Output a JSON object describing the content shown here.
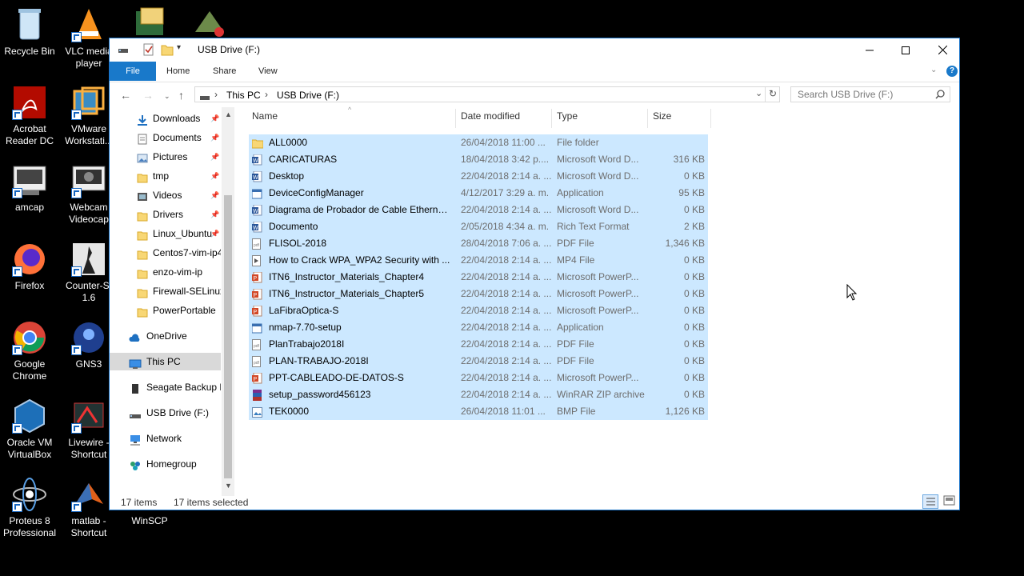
{
  "desktop": {
    "icons": [
      {
        "label": "Recycle Bin"
      },
      {
        "label": "VLC media player"
      },
      {
        "label": "Acrobat Reader DC"
      },
      {
        "label": "VMware Workstati..."
      },
      {
        "label": "amcap"
      },
      {
        "label": "Webcam Videocap"
      },
      {
        "label": "Firefox"
      },
      {
        "label": "Counter-St 1.6"
      },
      {
        "label": "Google Chrome"
      },
      {
        "label": "GNS3"
      },
      {
        "label": "Oracle VM VirtualBox"
      },
      {
        "label": "Livewire - Shortcut"
      },
      {
        "label": "Proteus 8 Professional"
      },
      {
        "label": "matlab - Shortcut"
      },
      {
        "label": "WinSCP"
      }
    ]
  },
  "window": {
    "title": "USB Drive (F:)",
    "ribbon_tabs": [
      "File",
      "Home",
      "Share",
      "View"
    ],
    "address": {
      "segments": [
        "This PC",
        "USB Drive (F:)"
      ]
    },
    "search_placeholder": "Search USB Drive (F:)",
    "nav": {
      "quick_access": [
        {
          "label": "Downloads",
          "pinned": true
        },
        {
          "label": "Documents",
          "pinned": true
        },
        {
          "label": "Pictures",
          "pinned": true
        },
        {
          "label": "tmp",
          "pinned": true
        },
        {
          "label": "Videos",
          "pinned": true
        },
        {
          "label": "Drivers",
          "pinned": true
        },
        {
          "label": "Linux_Ubuntu",
          "pinned": true
        },
        {
          "label": "Centos7-vim-ip4",
          "pinned": false
        },
        {
          "label": "enzo-vim-ip",
          "pinned": false
        },
        {
          "label": "Firewall-SELinux",
          "pinned": false
        },
        {
          "label": "PowerPortable",
          "pinned": false
        }
      ],
      "locations": [
        {
          "label": "OneDrive"
        },
        {
          "label": "This PC"
        },
        {
          "label": "Seagate Backup P"
        },
        {
          "label": "USB Drive (F:)"
        },
        {
          "label": "Network"
        },
        {
          "label": "Homegroup"
        }
      ]
    },
    "columns": [
      "Name",
      "Date modified",
      "Type",
      "Size"
    ],
    "files": [
      {
        "name": "ALL0000",
        "date": "26/04/2018 11:00 ...",
        "type": "File folder",
        "size": "",
        "icon": "folder"
      },
      {
        "name": "CARICATURAS",
        "date": "18/04/2018 3:42 p....",
        "type": "Microsoft Word D...",
        "size": "316 KB",
        "icon": "word"
      },
      {
        "name": "Desktop",
        "date": "22/04/2018 2:14 a. ...",
        "type": "Microsoft Word D...",
        "size": "0 KB",
        "icon": "word"
      },
      {
        "name": "DeviceConfigManager",
        "date": "4/12/2017 3:29 a. m.",
        "type": "Application",
        "size": "95 KB",
        "icon": "app"
      },
      {
        "name": "Diagrama de Probador de Cable Ethernet...",
        "date": "22/04/2018 2:14 a. ...",
        "type": "Microsoft Word D...",
        "size": "0 KB",
        "icon": "word"
      },
      {
        "name": "Documento",
        "date": "2/05/2018 4:34 a. m.",
        "type": "Rich Text Format",
        "size": "2 KB",
        "icon": "word"
      },
      {
        "name": "FLISOL-2018",
        "date": "28/04/2018 7:06 a. ...",
        "type": "PDF File",
        "size": "1,346 KB",
        "icon": "pdf"
      },
      {
        "name": "How to Crack WPA_WPA2 Security with ...",
        "date": "22/04/2018 2:14 a. ...",
        "type": "MP4 File",
        "size": "0 KB",
        "icon": "video"
      },
      {
        "name": "ITN6_Instructor_Materials_Chapter4",
        "date": "22/04/2018 2:14 a. ...",
        "type": "Microsoft PowerP...",
        "size": "0 KB",
        "icon": "ppt"
      },
      {
        "name": "ITN6_Instructor_Materials_Chapter5",
        "date": "22/04/2018 2:14 a. ...",
        "type": "Microsoft PowerP...",
        "size": "0 KB",
        "icon": "ppt"
      },
      {
        "name": "LaFibraOptica-S",
        "date": "22/04/2018 2:14 a. ...",
        "type": "Microsoft PowerP...",
        "size": "0 KB",
        "icon": "ppt"
      },
      {
        "name": "nmap-7.70-setup",
        "date": "22/04/2018 2:14 a. ...",
        "type": "Application",
        "size": "0 KB",
        "icon": "app"
      },
      {
        "name": "PlanTrabajo2018I",
        "date": "22/04/2018 2:14 a. ...",
        "type": "PDF File",
        "size": "0 KB",
        "icon": "pdf"
      },
      {
        "name": "PLAN-TRABAJO-2018I",
        "date": "22/04/2018 2:14 a. ...",
        "type": "PDF File",
        "size": "0 KB",
        "icon": "pdf"
      },
      {
        "name": "PPT-CABLEADO-DE-DATOS-S",
        "date": "22/04/2018 2:14 a. ...",
        "type": "Microsoft PowerP...",
        "size": "0 KB",
        "icon": "ppt"
      },
      {
        "name": "setup_password456123",
        "date": "22/04/2018 2:14 a. ...",
        "type": "WinRAR ZIP archive",
        "size": "0 KB",
        "icon": "rar"
      },
      {
        "name": "TEK0000",
        "date": "26/04/2018 11:01 ...",
        "type": "BMP File",
        "size": "1,126 KB",
        "icon": "bmp"
      }
    ],
    "status": {
      "count": "17 items",
      "selected": "17 items selected"
    }
  },
  "colors": {
    "accent": "#1979ca",
    "selection": "#cce8ff",
    "folder": "#f8d775"
  }
}
